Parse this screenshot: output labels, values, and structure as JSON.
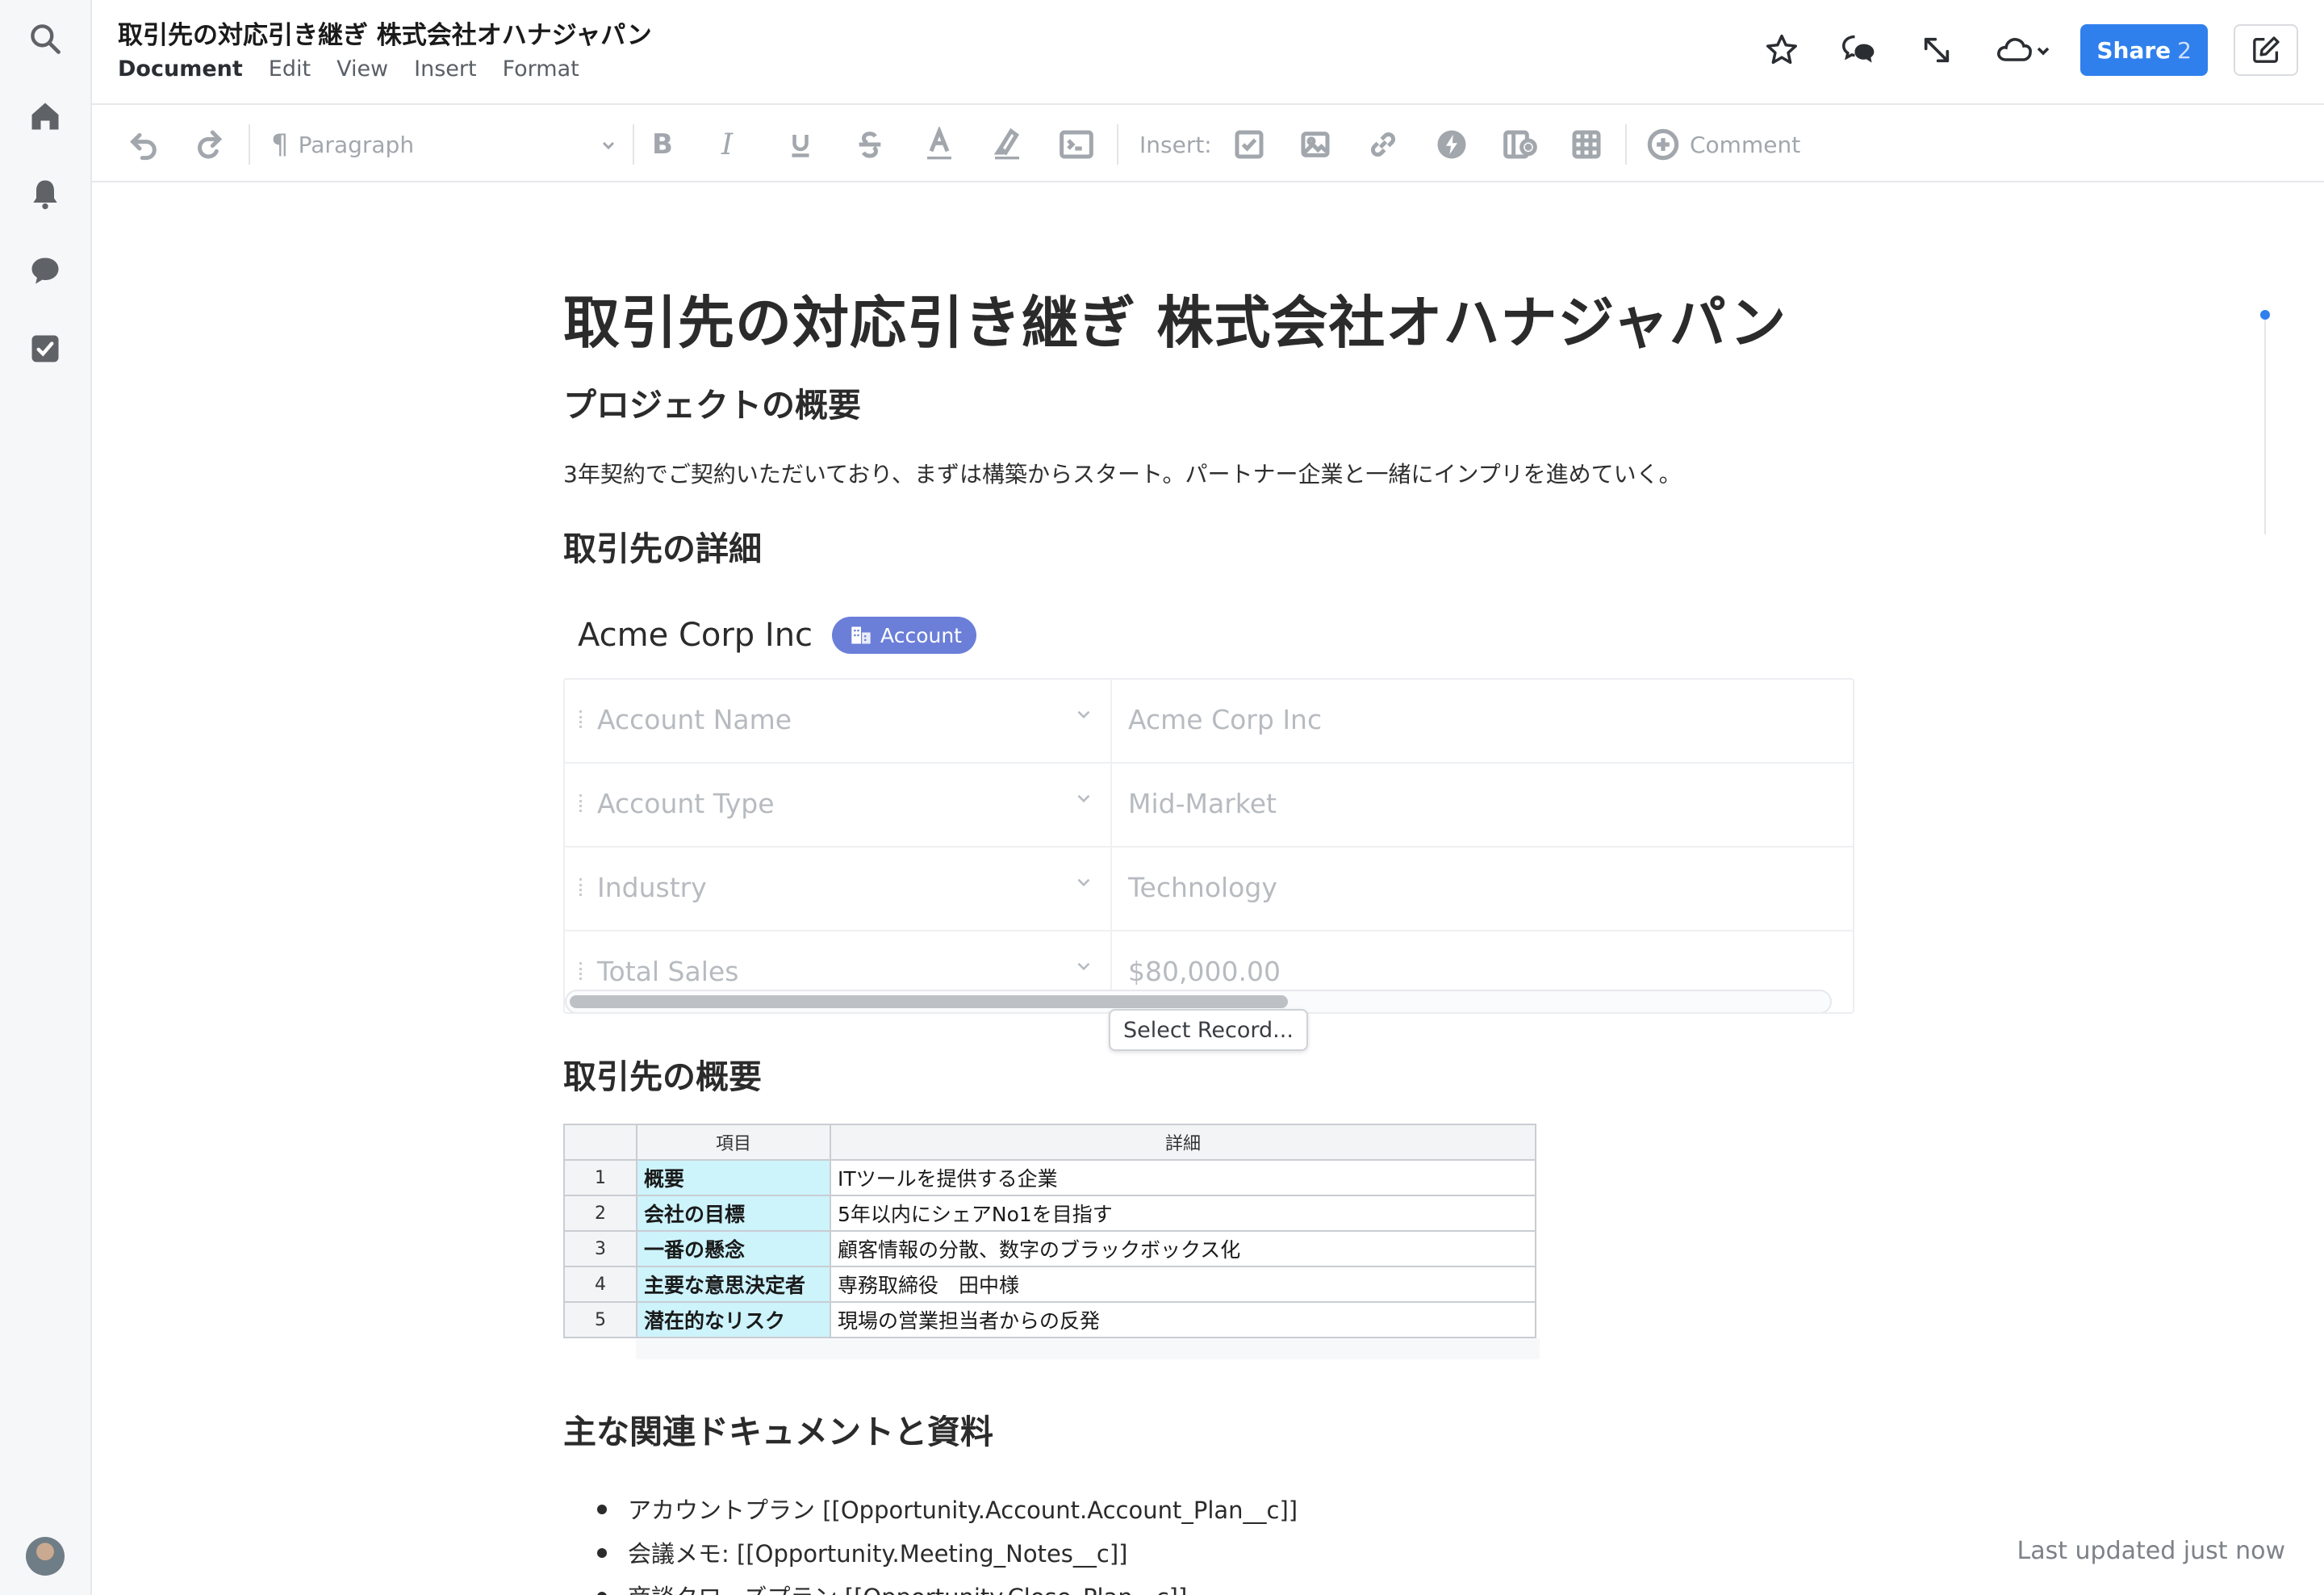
{
  "header": {
    "title": "取引先の対応引き継ぎ 株式会社オハナジャパン",
    "menu": [
      "Document",
      "Edit",
      "View",
      "Insert",
      "Format"
    ],
    "share_label": "Share",
    "share_count": "2"
  },
  "toolbar": {
    "paragraph_label": "Paragraph",
    "insert_label": "Insert:",
    "comment_label": "Comment"
  },
  "document": {
    "title": "取引先の対応引き継ぎ 株式会社オハナジャパン",
    "section1": "プロジェクトの概要",
    "paragraph": "3年契約でご契約いただいており、まずは構築からスタート。パートナー企業と一緒にインプリを進めていく。",
    "section2": "取引先の詳細",
    "record": {
      "name": "Acme Corp Inc",
      "badge": "Account",
      "rows": [
        {
          "label": "Account Name",
          "value": "Acme Corp Inc"
        },
        {
          "label": "Account Type",
          "value": "Mid-Market"
        },
        {
          "label": "Industry",
          "value": "Technology"
        },
        {
          "label": "Total Sales",
          "value": "$80,000.00"
        }
      ],
      "select_record": "Select Record..."
    },
    "section3": "取引先の概要",
    "table": {
      "headers": [
        "項目",
        "詳細"
      ],
      "rows": [
        {
          "num": "1",
          "item": "概要",
          "detail": "ITツールを提供する企業"
        },
        {
          "num": "2",
          "item": "会社の目標",
          "detail": "5年以内にシェアNo1を目指す"
        },
        {
          "num": "3",
          "item": "一番の懸念",
          "detail": "顧客情報の分散、数字のブラックボックス化"
        },
        {
          "num": "4",
          "item": "主要な意思決定者",
          "detail": "専務取締役　田中様"
        },
        {
          "num": "5",
          "item": "潜在的なリスク",
          "detail": "現場の営業担当者からの反発"
        }
      ]
    },
    "section4": "主な関連ドキュメントと資料",
    "bullets": [
      "アカウントプラン [[Opportunity.Account.Account_Plan__c]]",
      "会議メモ: [[Opportunity.Meeting_Notes__c]]",
      "商談クローズプラン [[Opportunity.Close_Plan__c]]"
    ]
  },
  "footer": {
    "last_updated": "Last updated just now"
  },
  "colors": {
    "accent": "#2f80ed",
    "badge": "#6b7fd8",
    "highlight_cell": "#cdf3fb"
  }
}
